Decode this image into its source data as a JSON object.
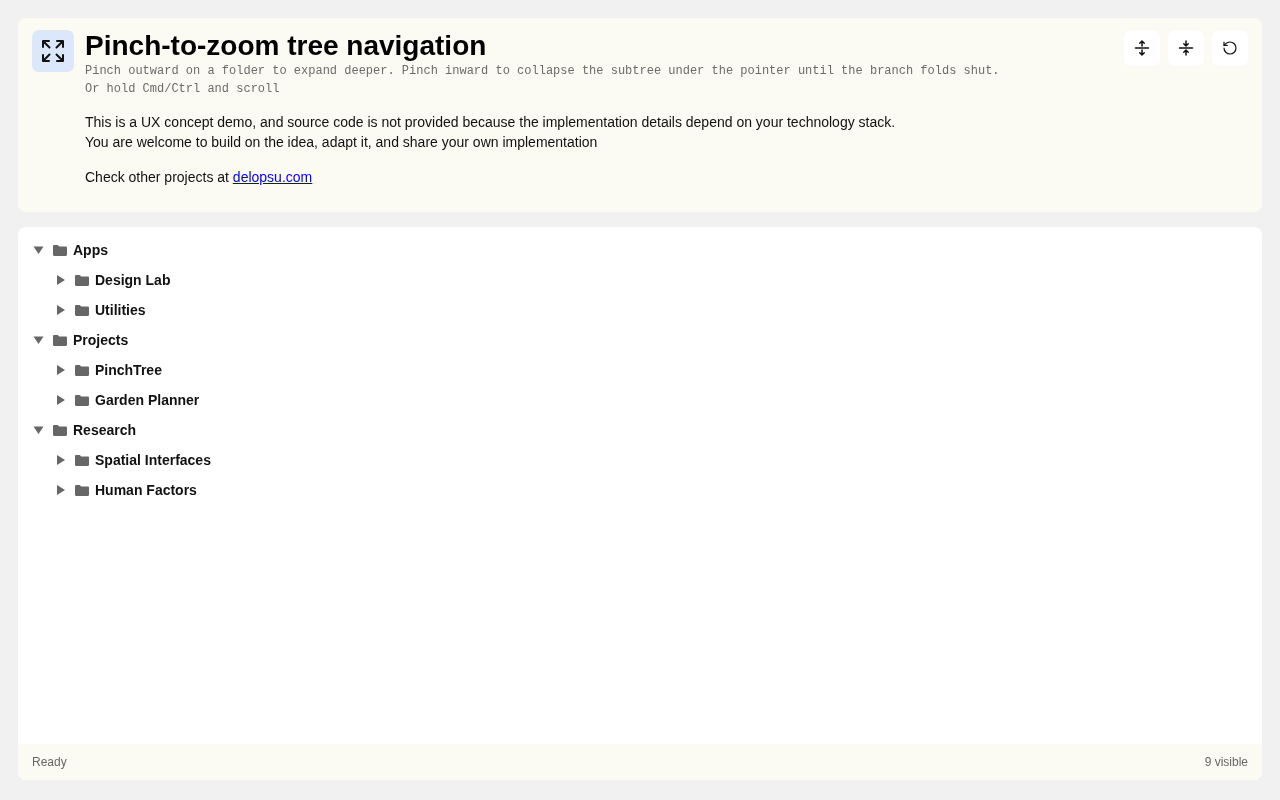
{
  "header": {
    "title": "Pinch-to-zoom tree navigation",
    "hint_lines": [
      "Pinch outward on a folder to expand deeper. Pinch inward to collapse the subtree under the pointer until the branch folds shut.",
      "Or hold Cmd/Ctrl and scroll"
    ],
    "intro_lines": [
      "This is a UX concept demo, and source code is not provided because the implementation details depend on your technology stack.",
      "You are welcome to build on the idea, adapt it, and share your own implementation"
    ],
    "projects_line": {
      "text": "Check other projects at",
      "link": "delopsu.com"
    }
  },
  "toolbar": {
    "buttons": [
      {
        "kind": "expand_all"
      },
      {
        "kind": "collapse_all"
      },
      {
        "kind": "reset"
      }
    ]
  },
  "tree": {
    "items": [
      {
        "label": "Apps",
        "expanded": true,
        "children": [
          {
            "label": "Design Lab",
            "expanded": false
          },
          {
            "label": "Utilities",
            "expanded": false
          }
        ]
      },
      {
        "label": "Projects",
        "expanded": true,
        "children": [
          {
            "label": "PinchTree",
            "expanded": false
          },
          {
            "label": "Garden Planner",
            "expanded": false
          }
        ]
      },
      {
        "label": "Research",
        "expanded": true,
        "children": [
          {
            "label": "Spatial Interfaces",
            "expanded": false
          },
          {
            "label": "Human Factors",
            "expanded": false
          }
        ]
      }
    ]
  },
  "status_bar": {
    "left": "Ready",
    "right": "9 visible"
  }
}
